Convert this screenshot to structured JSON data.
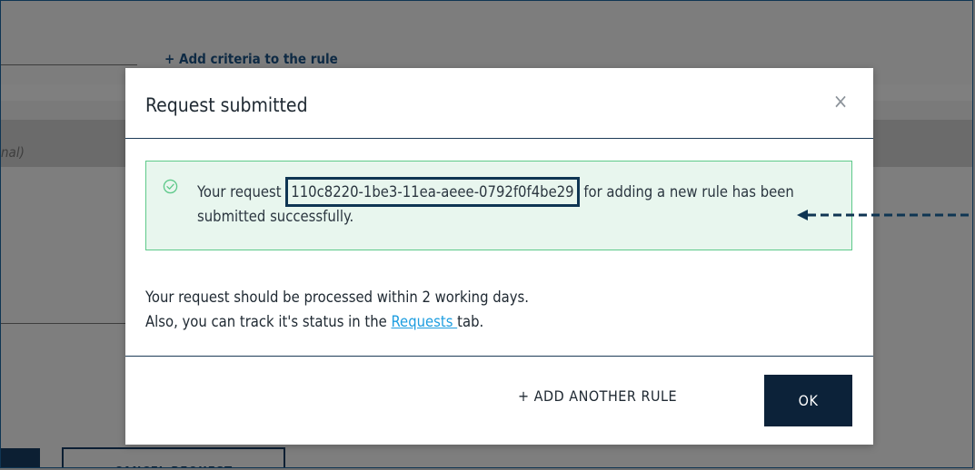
{
  "background": {
    "add_criteria_label": "+ Add criteria to the rule",
    "optional_fragment": "nal)",
    "cancel_request_label": "CANCEL REQUEST"
  },
  "modal": {
    "title": "Request submitted",
    "close_symbol": "×",
    "alert": {
      "icon": "check-circle-icon",
      "text_before": "Your request ",
      "request_id": "110c8220-1be3-11ea-aeee-0792f0f4be29",
      "text_after": " for adding a new rule has been submitted successfully."
    },
    "info": {
      "line1": "Your request should be processed within 2 working days.",
      "line2_before": "Also, you can track it's status in the ",
      "line2_link": "Requests ",
      "line2_after": "tab."
    },
    "buttons": {
      "add_another_rule": "+ ADD ANOTHER RULE",
      "ok": "OK"
    }
  },
  "colors": {
    "primary_dark": "#0c2239",
    "success_border": "#5ec98a",
    "success_bg": "#e8f6ee",
    "link": "#1e9ee0",
    "annotation": "#0f3553"
  }
}
